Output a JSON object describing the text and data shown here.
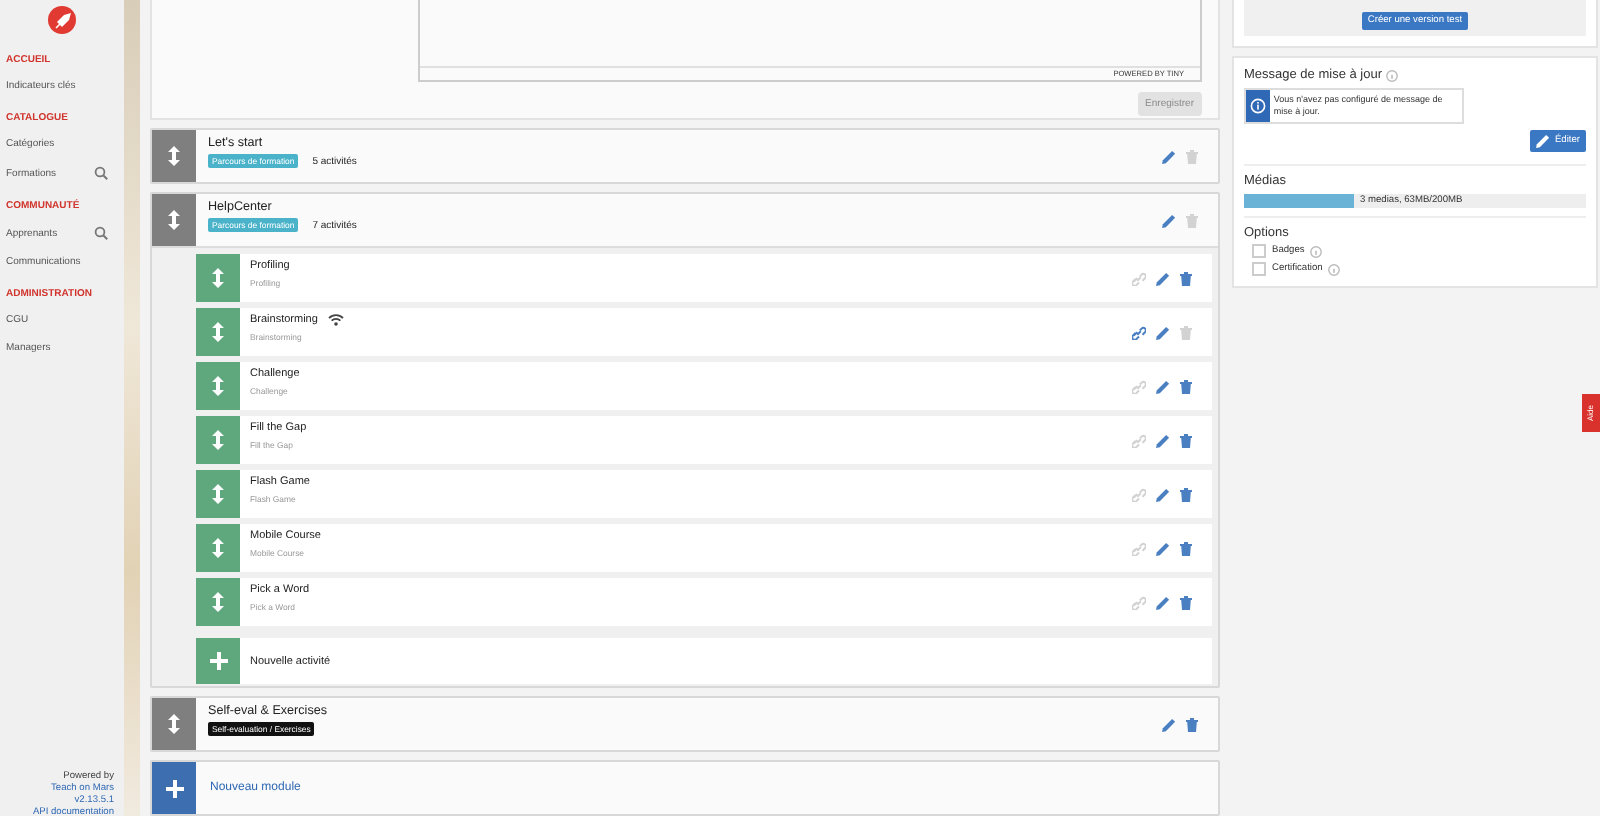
{
  "sidebar": {
    "sections": [
      {
        "title": "ACCUEIL",
        "items": [
          {
            "label": "Indicateurs clés",
            "search": false
          }
        ]
      },
      {
        "title": "CATALOGUE",
        "items": [
          {
            "label": "Catégories",
            "search": false
          },
          {
            "label": "Formations",
            "search": true
          }
        ]
      },
      {
        "title": "COMMUNAUTÉ",
        "items": [
          {
            "label": "Apprenants",
            "search": true
          },
          {
            "label": "Communications",
            "search": false
          }
        ]
      },
      {
        "title": "ADMINISTRATION",
        "items": [
          {
            "label": "CGU",
            "search": false
          },
          {
            "label": "Managers",
            "search": false
          }
        ]
      }
    ],
    "footer": {
      "prefix": "Powered by",
      "link": "Teach on Mars",
      "version": "v2.13.5.1",
      "docs": "API documentation"
    }
  },
  "editor": {
    "footer": "POWERED BY TINY",
    "save_button": "Enregistrer",
    "save_disabled": true
  },
  "modules": [
    {
      "title": "Let's start",
      "tag": "Parcours de formation",
      "color": "#4bb3c9",
      "count": "5 activités",
      "delete_enabled": false,
      "expanded": false
    },
    {
      "title": "HelpCenter",
      "tag": "Parcours de formation",
      "color": "#4bb3c9",
      "count": "7 activités",
      "delete_enabled": false,
      "expanded": true,
      "activities": [
        {
          "title": "Profiling",
          "subtitle": "Profiling",
          "link_enabled": false,
          "delete_enabled": true,
          "wifi": false
        },
        {
          "title": "Brainstorming",
          "subtitle": "Brainstorming",
          "link_enabled": true,
          "delete_enabled": false,
          "wifi": true
        },
        {
          "title": "Challenge",
          "subtitle": "Challenge",
          "link_enabled": false,
          "delete_enabled": true,
          "wifi": false
        },
        {
          "title": "Fill the Gap",
          "subtitle": "Fill the Gap",
          "link_enabled": false,
          "delete_enabled": true,
          "wifi": false
        },
        {
          "title": "Flash Game",
          "subtitle": "Flash Game",
          "link_enabled": false,
          "delete_enabled": true,
          "wifi": false
        },
        {
          "title": "Mobile Course",
          "subtitle": "Mobile Course",
          "link_enabled": false,
          "delete_enabled": true,
          "wifi": false
        },
        {
          "title": "Pick a Word",
          "subtitle": "Pick a Word",
          "link_enabled": false,
          "delete_enabled": true,
          "wifi": false
        }
      ],
      "new_activity": "Nouvelle activité"
    },
    {
      "title": "Self-eval & Exercises",
      "tag": "Self-evaluation / Exercises",
      "color": "#111111",
      "delete_enabled": true,
      "expanded": false
    }
  ],
  "new_module": "Nouveau module",
  "right": {
    "test_button": "Créer une version test",
    "update": {
      "title": "Message de mise à jour",
      "message": "Vous n'avez pas configuré de message de mise à jour.",
      "edit_button": "Éditer"
    },
    "media": {
      "title": "Médias",
      "level": 0.32,
      "reading": "3 medias, 63MB/200MB"
    },
    "options": {
      "title": "Options",
      "items": [
        {
          "label": "Badges",
          "checked": false
        },
        {
          "label": "Certification",
          "checked": false
        }
      ]
    }
  },
  "help_tab": "Aide"
}
